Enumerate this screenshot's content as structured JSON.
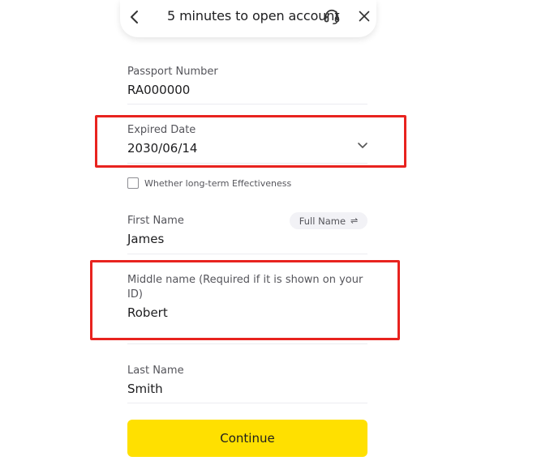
{
  "header": {
    "title": "5 minutes to open account"
  },
  "form": {
    "passport": {
      "label": "Passport Number",
      "value": "RA000000"
    },
    "expired": {
      "label": "Expired Date",
      "value": "2030/06/14"
    },
    "long_term": {
      "label": "Whether long-term Effectiveness",
      "checked": false
    },
    "first_name": {
      "label": "First Name",
      "value": "James"
    },
    "full_name_toggle": {
      "label": "Full Name",
      "icon": "⇌"
    },
    "middle_name": {
      "label": "Middle name (Required if it is shown on your ID)",
      "value": "Robert"
    },
    "last_name": {
      "label": "Last Name",
      "value": "Smith"
    }
  },
  "actions": {
    "continue_label": "Continue"
  },
  "colors": {
    "accent": "#ffe000",
    "highlight": "#e8231f",
    "divider": "#ececf0"
  },
  "icons": {
    "back": "chevron-left-icon",
    "support": "headset-icon",
    "close": "close-icon",
    "dropdown": "chevron-down-icon",
    "swap": "swap-icon"
  }
}
